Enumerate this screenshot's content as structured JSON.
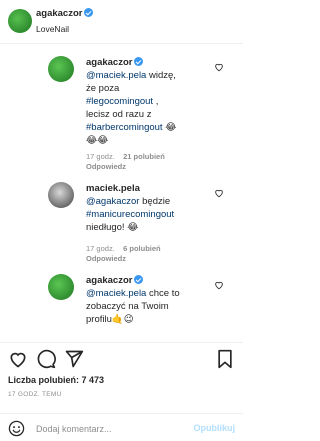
{
  "header": {
    "username": "agakaczor",
    "subtitle": "LoveNail"
  },
  "comments": [
    {
      "username": "agakaczor",
      "verified": true,
      "lines": [
        "@maciek.pela widzę, że poza",
        "#legocomingout ,",
        "lecisz od razu z",
        "#barbercomingout 😂",
        "😂😂"
      ],
      "mention": "@maciek.pela",
      "text1": " widzę,",
      "text2": "że poza",
      "tag1": "#legocomingout",
      "text3": " ,",
      "text4": "lecisz od razu z",
      "tag2": "#barbercomingout",
      "emoji1": " 😂",
      "emoji2": "😂😂",
      "time": "17 godz.",
      "likes": "21 polubień",
      "reply": "Odpowiedz"
    },
    {
      "username": "maciek.pela",
      "mention": "@agakaczor",
      "text1": " będzie",
      "tag1": "#manicurecomingout",
      "text2": "niedługo! 😂",
      "time": "17 godz.",
      "likes": "6 polubień",
      "reply": "Odpowiedz"
    },
    {
      "username": "agakaczor",
      "verified": true,
      "mention": "@maciek.pela",
      "text1": " chce to",
      "text2": "zobaczyć na Twoim",
      "text3": "profilu🤙😉"
    }
  ],
  "footer": {
    "likes": "Liczba polubień: 7 473",
    "time": "17 GODZ. TEMU",
    "placeholder": "Dodaj komentarz...",
    "publish": "Opublikuj"
  },
  "colors": {
    "link": "#00376b",
    "verified": "#3897f0",
    "publish_disabled": "#b2dffc",
    "meta": "#8e8e8e"
  }
}
